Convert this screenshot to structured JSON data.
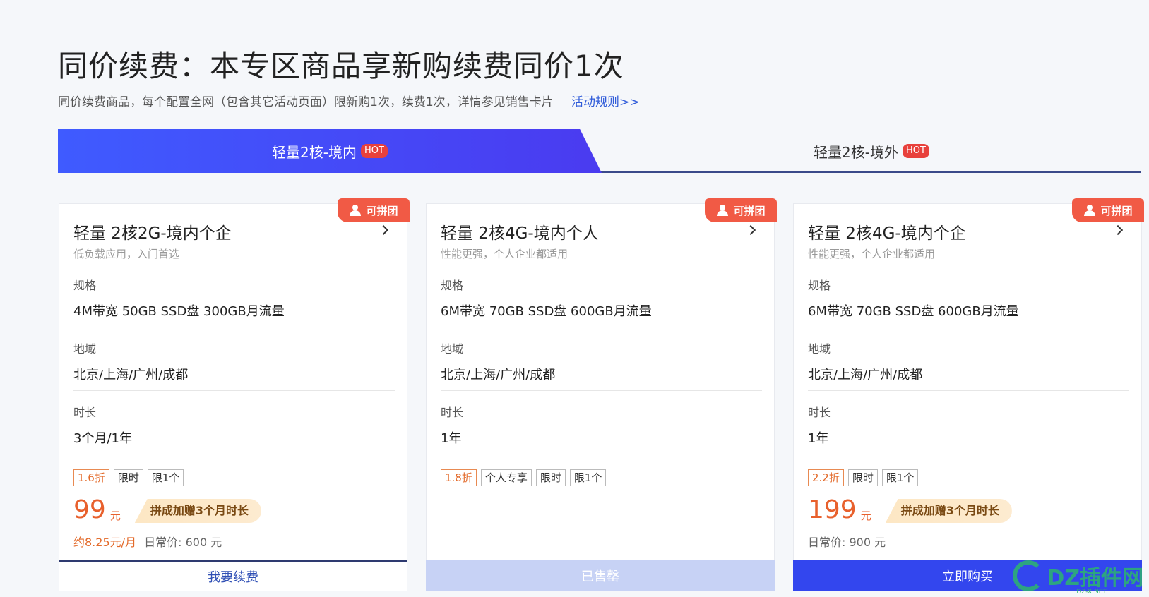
{
  "header": {
    "title": "同价续费：本专区商品享新购续费同价1次",
    "subtitle": "同价续费商品，每个配置全网（包含其它活动页面）限新购1次，续费1次，详情参见销售卡片",
    "rules_link": "活动规则>>"
  },
  "tabs": [
    {
      "label": "轻量2核-境内",
      "badge": "HOT",
      "active": true
    },
    {
      "label": "轻量2核-境外",
      "badge": "HOT",
      "active": false
    }
  ],
  "cards": [
    {
      "badge": "可拼团",
      "title": "轻量 2核2G-境内个企",
      "desc": "低负载应用，入门首选",
      "spec_label": "规格",
      "spec_value": "4M带宽 50GB SSD盘 300GB月流量",
      "region_label": "地域",
      "region_value": "北京/上海/广州/成都",
      "duration_label": "时长",
      "duration_value": "3个月/1年",
      "tags": [
        "1.6折",
        "限时",
        "限1个"
      ],
      "price": "99",
      "unit": "元",
      "promo": "拼成加赠3个月时长",
      "monthly": "约8.25元/月",
      "regular": "日常价: 600 元",
      "button": "我要续费"
    },
    {
      "badge": "可拼团",
      "title": "轻量 2核4G-境内个人",
      "desc": "性能更强，个人企业都适用",
      "spec_label": "规格",
      "spec_value": "6M带宽 70GB SSD盘 600GB月流量",
      "region_label": "地域",
      "region_value": "北京/上海/广州/成都",
      "duration_label": "时长",
      "duration_value": "1年",
      "tags": [
        "1.8折",
        "个人专享",
        "限时",
        "限1个"
      ],
      "button": "已售罄"
    },
    {
      "badge": "可拼团",
      "title": "轻量 2核4G-境内个企",
      "desc": "性能更强，个人企业都适用",
      "spec_label": "规格",
      "spec_value": "6M带宽 70GB SSD盘 600GB月流量",
      "region_label": "地域",
      "region_value": "北京/上海/广州/成都",
      "duration_label": "时长",
      "duration_value": "1年",
      "tags": [
        "2.2折",
        "限时",
        "限1个"
      ],
      "price": "199",
      "unit": "元",
      "promo": "拼成加赠3个月时长",
      "regular": "日常价: 900 元",
      "button": "立即购买"
    }
  ],
  "watermark": {
    "text": "DZ插件网",
    "sub": "DZ-X.NET"
  }
}
